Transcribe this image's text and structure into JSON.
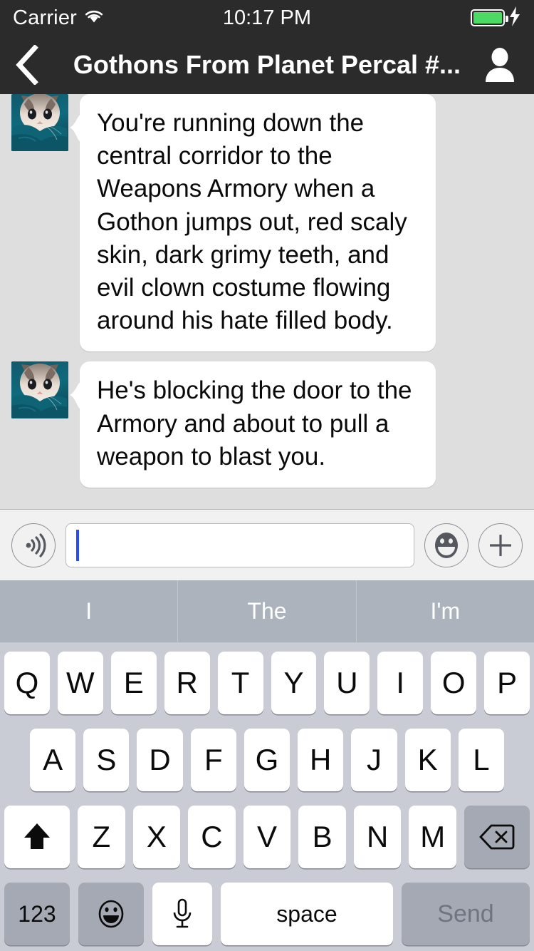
{
  "statusbar": {
    "carrier": "Carrier",
    "wifi_icon": "wifi-icon",
    "time": "10:17 PM",
    "battery_icon": "battery-full-icon",
    "charging_icon": "charging-bolt-icon",
    "battery_color": "#4cd964"
  },
  "navbar": {
    "back_icon": "chevron-left-icon",
    "title": "Gothons From Planet Percal #...",
    "contact_icon": "person-icon",
    "background": "#2b2b2b"
  },
  "chat": {
    "background": "#dedede",
    "messages": [
      {
        "avatar_name": "kitten-avatar",
        "text": "You're running down the central corridor to the Weapons Armory when a Gothon jumps out, red scaly skin, dark grimy teeth, and evil clown costume flowing around his hate filled body."
      },
      {
        "avatar_name": "kitten-avatar",
        "text": "He's blocking the door to the Armory and about to pull a weapon to blast you."
      }
    ]
  },
  "inputbar": {
    "voice_icon": "voice-wave-icon",
    "message_value": "",
    "message_placeholder": "",
    "caret_color": "#2b4cf5",
    "emoji_icon": "smiley-face-icon",
    "add_icon": "plus-icon"
  },
  "predictive": {
    "suggestions": [
      "I",
      "The",
      "I'm"
    ],
    "background": "#acb3bc"
  },
  "keyboard": {
    "background": "#c9ccd4",
    "row1": [
      "Q",
      "W",
      "E",
      "R",
      "T",
      "Y",
      "U",
      "I",
      "O",
      "P"
    ],
    "row2": [
      "A",
      "S",
      "D",
      "F",
      "G",
      "H",
      "J",
      "K",
      "L"
    ],
    "row3_letters": [
      "Z",
      "X",
      "C",
      "V",
      "B",
      "N",
      "M"
    ],
    "shift_icon": "shift-arrow-icon",
    "backspace_icon": "backspace-delete-icon",
    "numbers_label": "123",
    "emoji_icon": "smiley-face-icon",
    "mic_icon": "microphone-icon",
    "space_label": "space",
    "send_label": "Send"
  }
}
